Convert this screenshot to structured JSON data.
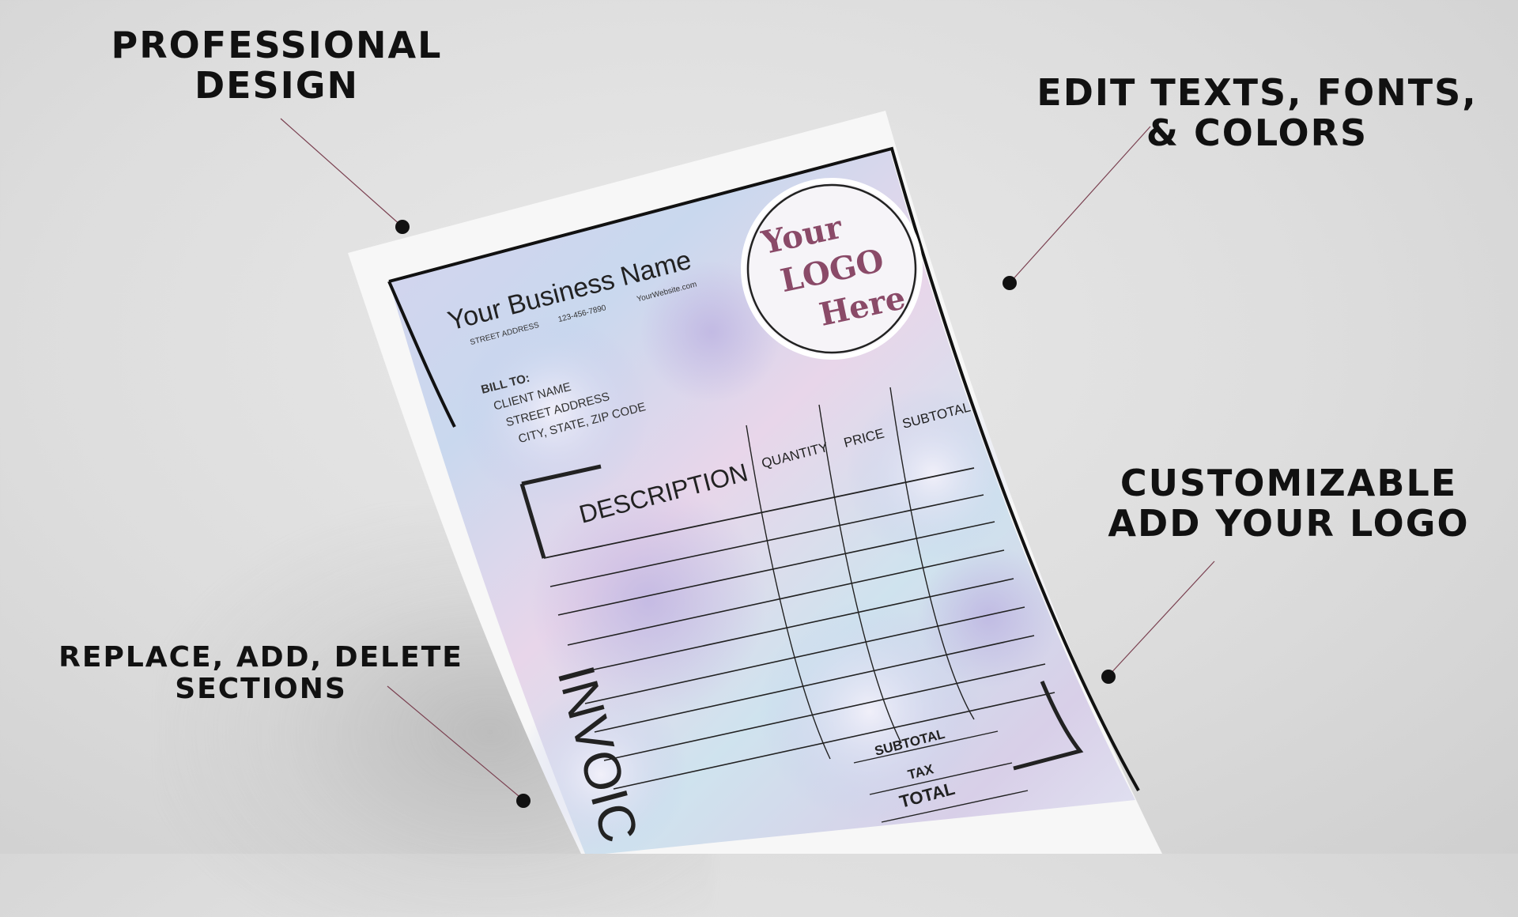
{
  "callouts": {
    "professional": {
      "line1": "PROFESSIONAL",
      "line2": "DESIGN"
    },
    "edit": {
      "line1": "EDIT TEXTS, FONTS,",
      "line2": "& COLORS"
    },
    "customizable": {
      "line1": "CUSTOMIZABLE",
      "line2": "ADD YOUR LOGO"
    },
    "replace": {
      "line1": "REPLACE, ADD, DELETE",
      "line2": "SECTIONS"
    }
  },
  "invoice": {
    "business_name": "Your Business Name",
    "street_address": "STREET ADDRESS",
    "phone": "123-456-7890",
    "website": "YourWebsite.com",
    "logo": {
      "line1": "Your",
      "line2": "LOGO",
      "line3": "Here"
    },
    "bill_to": {
      "label": "BILL TO:",
      "client_name": "CLIENT NAME",
      "street": "STREET ADDRESS",
      "city": "CITY, STATE, ZIP CODE"
    },
    "columns": {
      "description": "DESCRIPTION",
      "quantity": "QUANTITY",
      "price": "PRICE",
      "subtotal": "SUBTOTAL"
    },
    "totals": {
      "subtotal": "SUBTOTAL",
      "tax": "TAX",
      "total": "TOTAL"
    },
    "invoice_word": "INVOIC"
  },
  "colors": {
    "logo_text": "#8a4a68",
    "callout_text": "#111111"
  }
}
